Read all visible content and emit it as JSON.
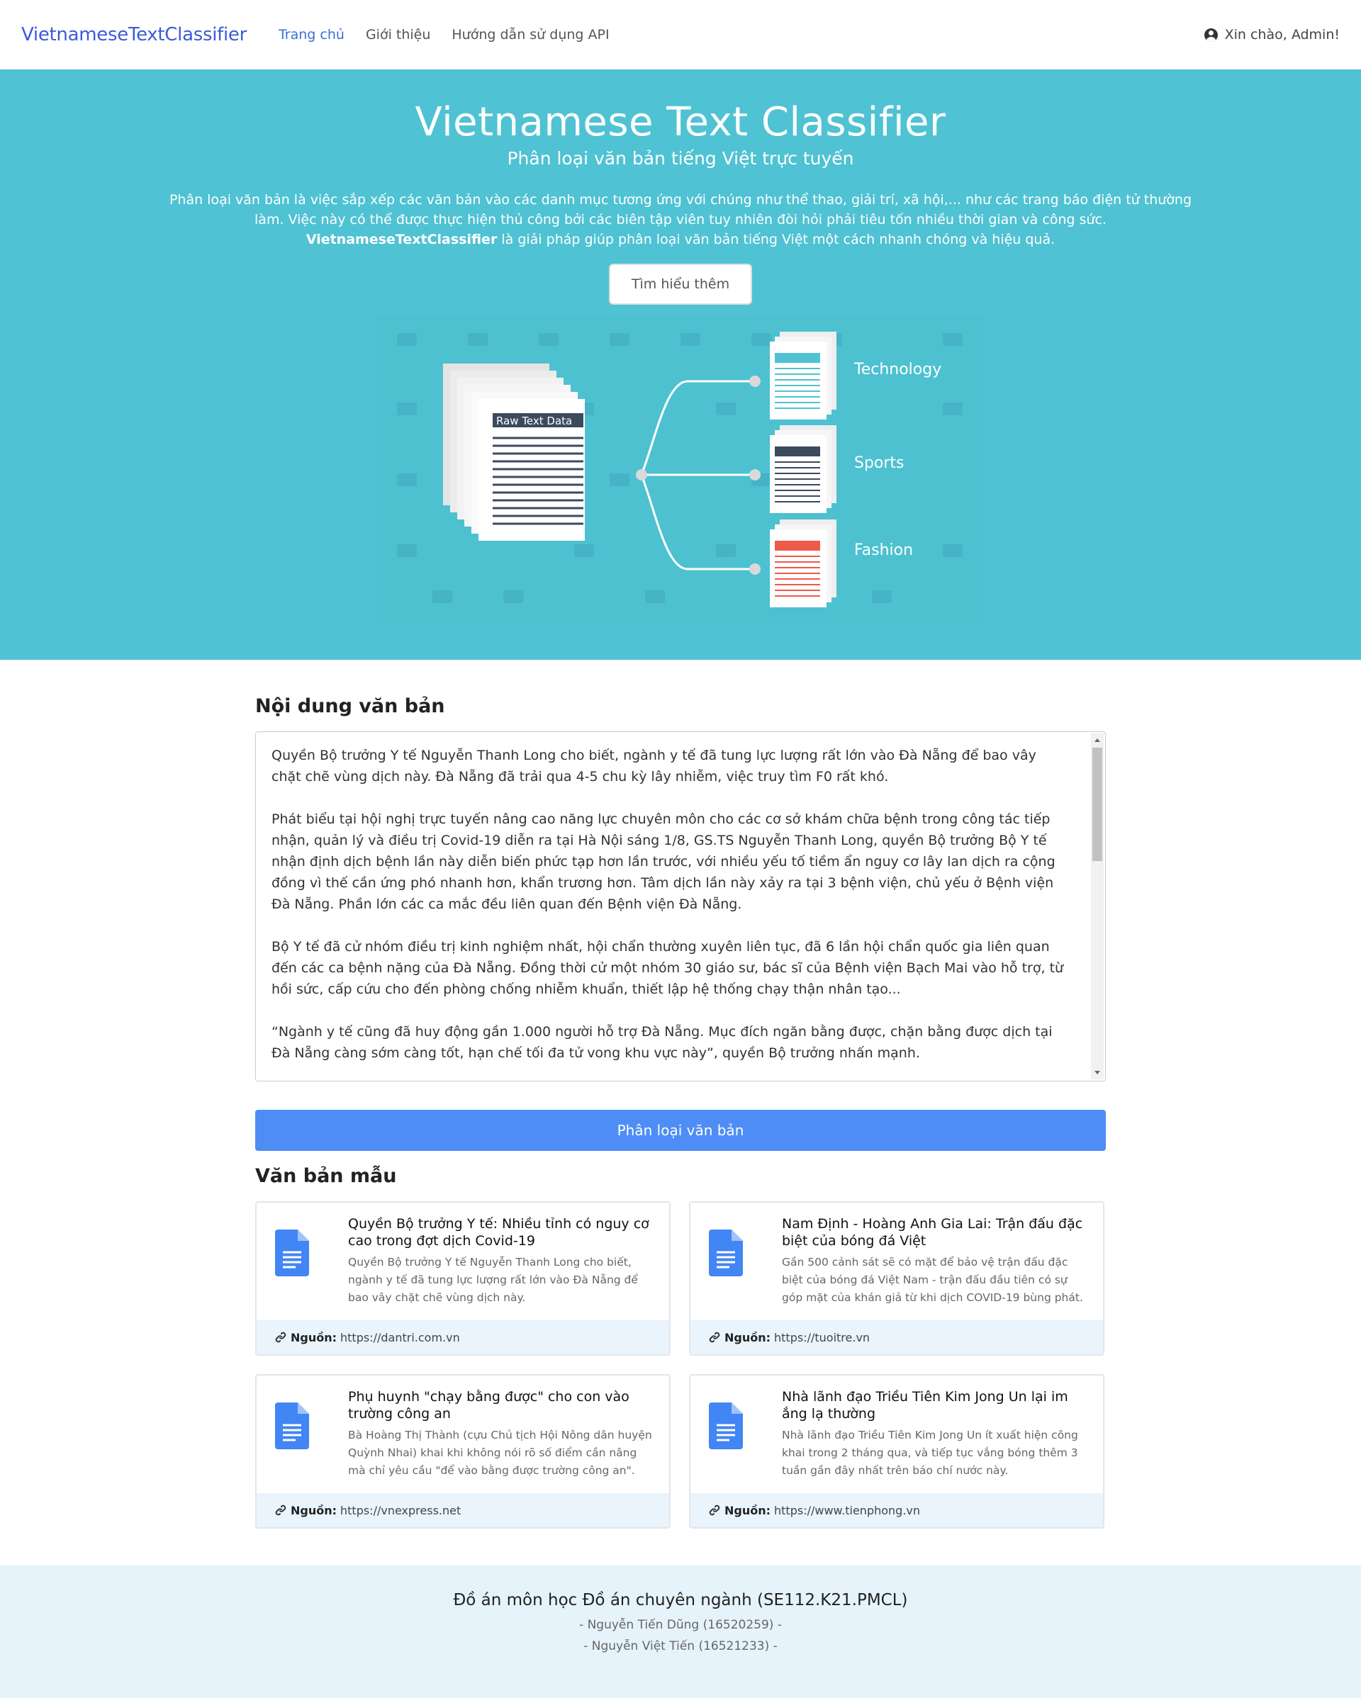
{
  "navbar": {
    "brand": "VietnameseTextClassifier",
    "links": [
      "Trang chủ",
      "Giới thiệu",
      "Hướng dẫn sử dụng API"
    ],
    "user_greeting": "Xin chào, Admin!"
  },
  "hero": {
    "title": "Vietnamese Text Classifier",
    "subtitle": "Phân loại văn bản tiếng Việt trực tuyến",
    "desc_part1": "Phân loại văn bản là việc sắp xếp các văn bản vào các danh mục tương ứng với chúng như thể thao, giải trí, xã hội,... như các trang báo điện tử thường làm. Việc này có thể được thực hiện thủ công bởi các biên tập viên tuy nhiên đòi hỏi phải tiêu tốn nhiều thời gian và công sức. ",
    "desc_bold": "VietnameseTextClassifier",
    "desc_part2": " là giải pháp giúp phân loại văn bản tiếng Việt một cách nhanh chóng và hiệu quả.",
    "button": "Tìm hiểu thêm",
    "illustration": {
      "raw_label": "Raw Text Data",
      "categories": [
        "Technology",
        "Sports",
        "Fashion"
      ]
    }
  },
  "content": {
    "section_title": "Nội dung văn bản",
    "text": "Quyền Bộ trưởng Y tế Nguyễn Thanh Long cho biết, ngành y tế đã tung lực lượng rất lớn vào Đà Nẵng để bao vây chặt chẽ vùng dịch này. Đà Nẵng đã trải qua 4-5 chu kỳ lây nhiễm, việc truy tìm F0 rất khó.\n\nPhát biểu tại hội nghị trực tuyến nâng cao năng lực chuyên môn cho các cơ sở khám chữa bệnh trong công tác tiếp nhận, quản lý và điều trị Covid-19 diễn ra tại Hà Nội sáng 1/8, GS.TS Nguyễn Thanh Long, quyền Bộ trưởng Bộ Y tế nhận định dịch bệnh lần này diễn biến phức tạp hơn lần trước, với nhiều yếu tố tiềm ẩn nguy cơ lây lan dịch ra cộng đồng vì thế cần ứng phó nhanh hơn, khẩn trương hơn. Tâm dịch lần này xảy ra tại 3 bệnh viện, chủ yếu ở Bệnh viện Đà Nẵng. Phần lớn các ca mắc đều liên quan đến Bệnh viện Đà Nẵng.\n\nBộ Y tế đã cử nhóm điều trị kinh nghiệm nhất, hội chẩn thường xuyên liên tục, đã 6 lần hội chẩn quốc gia liên quan đến các ca bệnh nặng của Đà Nẵng. Đồng thời cử một nhóm 30 giáo sư, bác sĩ của Bệnh viện Bạch Mai vào hỗ trợ, từ hồi sức, cấp cứu cho đến phòng chống nhiễm khuẩn, thiết lập hệ thống chạy thận nhân tạo...\n\n“Ngành y tế cũng đã huy động gần 1.000 người hỗ trợ Đà Nẵng. Mục đích ngăn bằng được, chặn bằng được dịch tại Đà Nẵng càng sớm càng tốt, hạn chế tối đa tử vong khu vực này”, quyền Bộ trưởng nhấn mạnh.",
    "classify_button": "Phân loại văn bản"
  },
  "samples": {
    "title": "Văn bản mẫu",
    "source_label": "Nguồn:",
    "items": [
      {
        "title": "Quyền Bộ trưởng Y tế: Nhiều tỉnh có nguy cơ cao trong đợt dịch Covid-19",
        "desc": "Quyền Bộ trưởng Y tế Nguyễn Thanh Long cho biết, ngành y tế đã tung lực lượng rất lớn vào Đà Nẵng để bao vây chặt chẽ vùng dịch này.",
        "source": "https://dantri.com.vn"
      },
      {
        "title": "Nam Định - Hoàng Anh Gia Lai: Trận đấu đặc biệt của bóng đá Việt",
        "desc": "Gần 500 cảnh sát sẽ có mặt để bảo vệ trận đấu đặc biệt của bóng đá Việt Nam - trận đấu đầu tiên có sự góp mặt của khán giả từ khi dịch COVID-19 bùng phát.",
        "source": "https://tuoitre.vn"
      },
      {
        "title": "Phụ huynh \"chạy bằng được\" cho con vào trường công an",
        "desc": "Bà Hoàng Thị Thành (cựu Chủ tịch Hội Nông dân huyện Quỳnh Nhai) khai khi không nói rõ số điểm cần nâng mà chỉ yêu cầu \"để vào bằng được trường công an\".",
        "source": "https://vnexpress.net"
      },
      {
        "title": "Nhà lãnh đạo Triều Tiên Kim Jong Un lại im ắng lạ thường",
        "desc": "Nhà lãnh đạo Triều Tiên Kim Jong Un ít xuất hiện công khai trong 2 tháng qua, và tiếp tục vắng bóng thêm 3 tuần gần đây nhất trên báo chí nước này.",
        "source": "https://www.tienphong.vn"
      }
    ]
  },
  "footer": {
    "title": "Đồ án môn học Đồ án chuyên ngành (SE112.K21.PMCL)",
    "authors": [
      "- Nguyễn Tiến Dũng (16520259) -",
      "- Nguyễn Việt Tiến (16521233) -"
    ]
  },
  "colors": {
    "hero_bg": "#4fc2d3",
    "brand": "#3b5bdb",
    "primary_button": "#4e8df5",
    "footer_bg": "#e6f3fb",
    "doc_icon": "#4285f4"
  }
}
